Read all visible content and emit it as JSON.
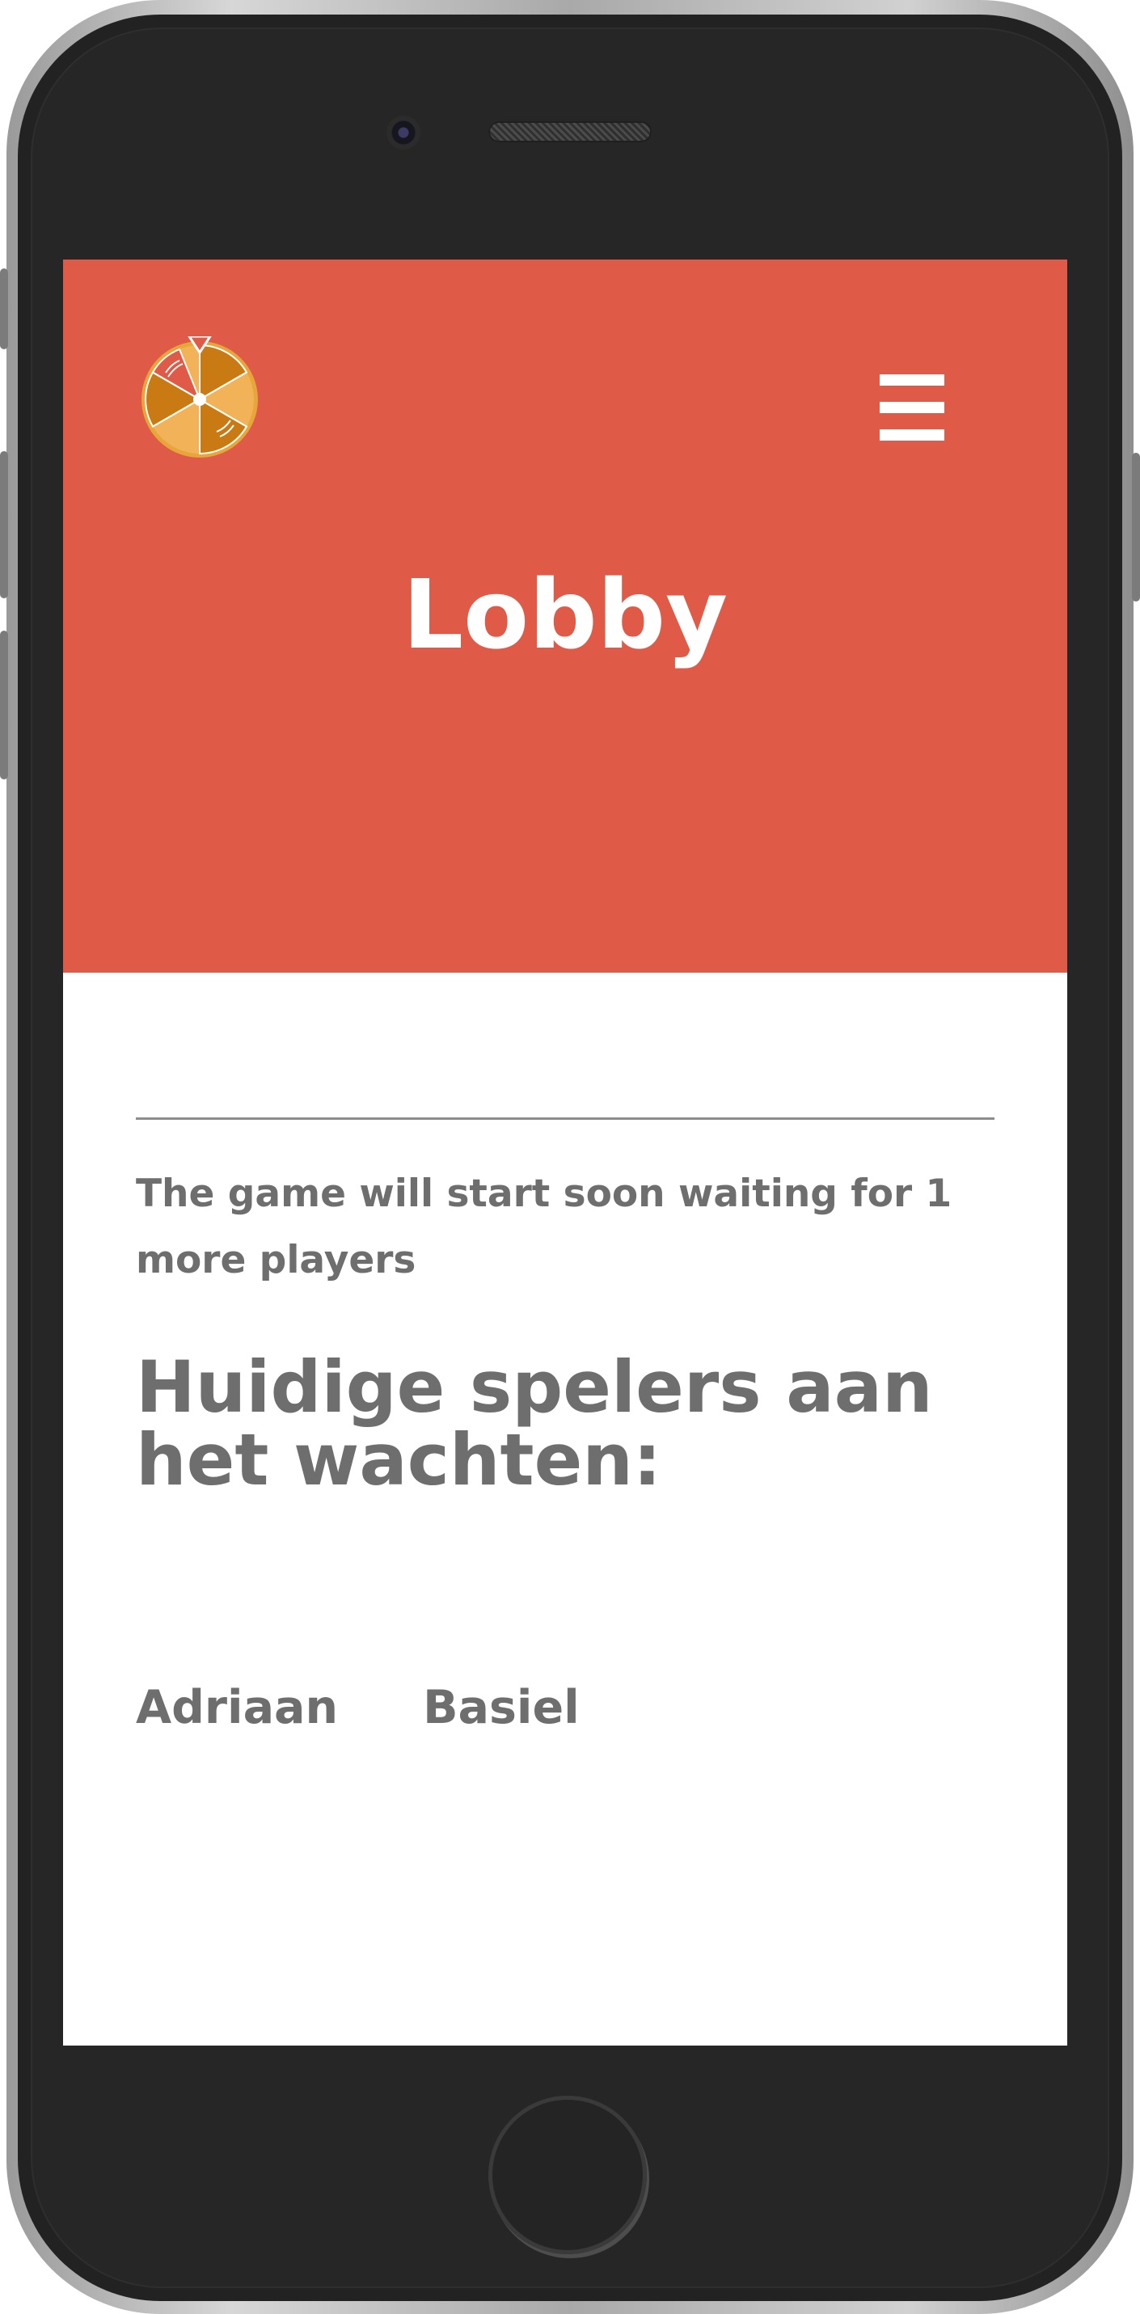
{
  "page": {
    "title": "Lobby",
    "status_message": "The game will start soon waiting for 1 more players",
    "players_heading": "Huidige spelers aan het wachten:",
    "players": [
      "Adriaan",
      "Basiel"
    ]
  },
  "icons": {
    "logo": "spinning-wheel-icon",
    "menu": "hamburger-menu-icon"
  },
  "colors": {
    "header_background": "#df5a47",
    "text": "#6e6e6e",
    "wheel_light": "#f2b257",
    "wheel_dark": "#c97a12",
    "wheel_red": "#df5a47"
  }
}
